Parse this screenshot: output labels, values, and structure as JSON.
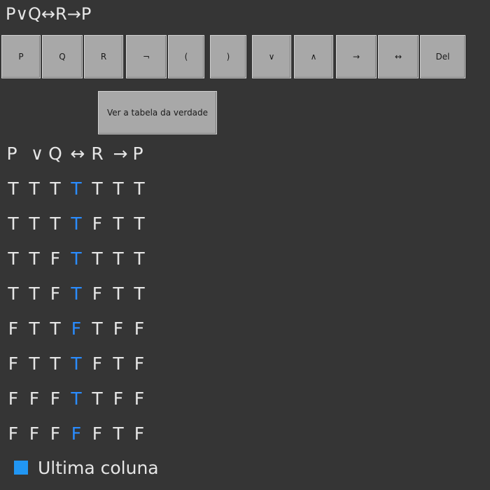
{
  "expression": "P∨Q↔R→P",
  "keypad": {
    "p": "P",
    "q": "Q",
    "r": "R",
    "not": "¬",
    "open_paren": "(",
    "close_paren": ")",
    "or": "∨",
    "and": "∧",
    "implies": "→",
    "iff": "↔",
    "delete": "Del"
  },
  "show_table_label": "Ver a tabela da verdade",
  "truth_table": {
    "header": [
      "P",
      "∨",
      "Q",
      "↔",
      "R",
      "→",
      "P"
    ],
    "rows": [
      [
        "T",
        "T",
        "T",
        "T",
        "T",
        "T",
        "T"
      ],
      [
        "T",
        "T",
        "T",
        "T",
        "F",
        "T",
        "T"
      ],
      [
        "T",
        "T",
        "F",
        "T",
        "T",
        "T",
        "T"
      ],
      [
        "T",
        "T",
        "F",
        "T",
        "F",
        "T",
        "T"
      ],
      [
        "F",
        "T",
        "T",
        "F",
        "T",
        "F",
        "F"
      ],
      [
        "F",
        "T",
        "T",
        "T",
        "F",
        "T",
        "F"
      ],
      [
        "F",
        "F",
        "F",
        "T",
        "T",
        "F",
        "F"
      ],
      [
        "F",
        "F",
        "F",
        "F",
        "F",
        "T",
        "F"
      ]
    ]
  },
  "legend": {
    "label": "Ultima coluna",
    "color": "#2196f3"
  }
}
